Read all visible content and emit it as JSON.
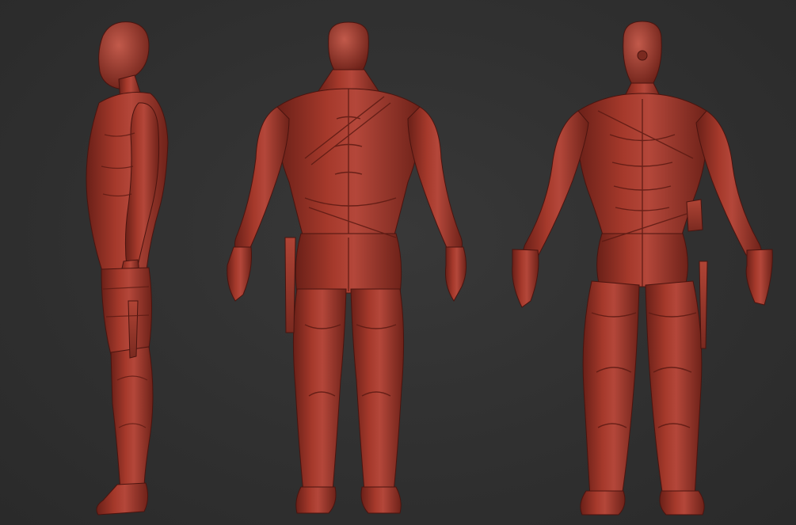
{
  "scene": {
    "background_color": "#2f2f2f",
    "model_color": "#9a3326",
    "model_highlight": "#c0564a",
    "model_shadow": "#5e1c15",
    "views": [
      {
        "id": "side",
        "icon": "side-view-figure"
      },
      {
        "id": "back",
        "icon": "back-view-figure"
      },
      {
        "id": "front",
        "icon": "front-view-figure"
      }
    ]
  }
}
